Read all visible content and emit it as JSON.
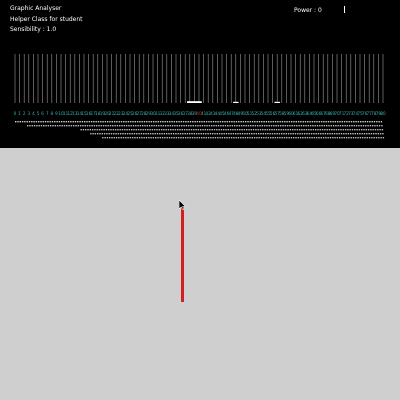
{
  "header": {
    "title": "Graphic Analyser",
    "subtitle": "Helper Class for student",
    "sensibility": "Sensibility : 1.0",
    "power": "Power : 0"
  },
  "analyser": {
    "band_count": 81,
    "label_color": "#3cb0b0",
    "highlight_color": "#d21f1f",
    "highlight_index": 40,
    "line_color": "#9a9a9a",
    "peaks": [
      {
        "index": 38,
        "level": 0.18
      },
      {
        "index": 39,
        "level": 0.18
      },
      {
        "index": 40,
        "level": 0.18
      },
      {
        "index": 48,
        "level": 0.12
      },
      {
        "index": 57,
        "level": 0.1
      }
    ]
  },
  "colors": {
    "top_background": "#000000",
    "bottom_background": "#cfcfcf",
    "indicator": "#d21f1f"
  },
  "icons": {
    "cursor": "mouse-pointer-icon"
  }
}
